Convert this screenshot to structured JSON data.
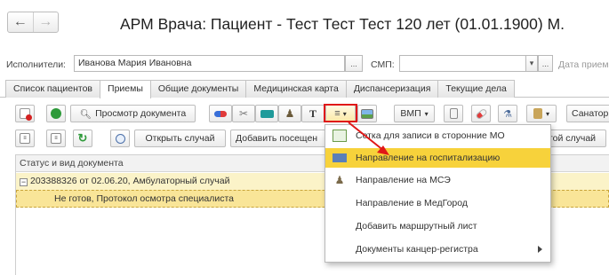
{
  "window": {
    "title": "АРМ Врача: Пациент - Тест Тест Тест 120 лет  (01.01.1900) М."
  },
  "nav": {
    "back_icon": "arrow-left-icon",
    "forward_icon": "arrow-right-icon"
  },
  "fields": {
    "executor_label": "Исполнители:",
    "executor_value": "Иванова Мария Ивановна",
    "executor_btn": "...",
    "smp_label": "СМП:",
    "smp_value": "",
    "smp_btn": "...",
    "date_label": "Дата прием"
  },
  "tabs": [
    {
      "label": "Список пациентов"
    },
    {
      "label": "Приемы",
      "active": true
    },
    {
      "label": "Общие документы"
    },
    {
      "label": "Медицинская карта"
    },
    {
      "label": "Диспансеризация"
    },
    {
      "label": "Текущие дела"
    }
  ],
  "toolbar1": {
    "view_document": "Просмотр документа",
    "t_button": "T",
    "vmp": "ВМП",
    "sanatorium": "Санатор"
  },
  "toolbar2": {
    "open_case": "Открыть случай",
    "add_visit": "Добавить посещен",
    "other_case": "гой случай"
  },
  "grid": {
    "header": "Статус и вид документа",
    "group_row": "203388326 от 02.06.20, Амбулаторный случай",
    "detail_row": "Не готов, Протокол осмотра специалиста"
  },
  "menu": {
    "items": [
      {
        "label": "Сетка для записи в сторонние МО",
        "icon": "grid-check-icon"
      },
      {
        "label": "Направление на госпитализацию",
        "icon": "hospital-bed-icon",
        "active": true
      },
      {
        "label": "Направление на МСЭ",
        "icon": "person-icon"
      },
      {
        "label": "Направление в МедГород",
        "icon": ""
      },
      {
        "label": "Добавить маршрутный лист",
        "icon": ""
      },
      {
        "label": "Документы канцер-регистра",
        "icon": "",
        "submenu": true
      }
    ]
  },
  "colors": {
    "menu_active": "#f7d23b",
    "highlight_border": "#e01818",
    "row_selected": "#f9e598",
    "row_group": "#fbf3c8"
  }
}
